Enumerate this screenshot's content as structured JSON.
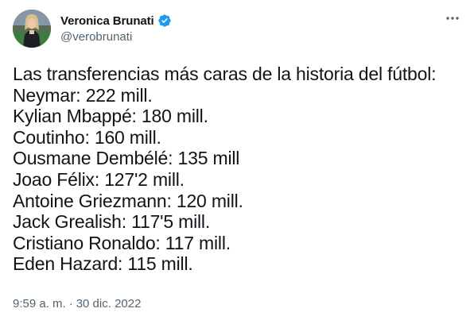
{
  "author": {
    "name": "Veronica Brunati",
    "handle": "@verobrunati",
    "verified": true
  },
  "tweet": {
    "lines": [
      "Las transferencias más caras de la historia del fútbol:",
      "Neymar: 222 mill.",
      "Kylian Mbappé: 180 mill.",
      "Coutinho: 160 mill.",
      "Ousmane Dembélé: 135 mill",
      "Joao Félix: 127'2 mill.",
      "Antoine Griezmann: 120 mill.",
      "Jack Grealish: 117'5 mill.",
      "Cristiano Ronaldo: 117 mill.",
      "Eden Hazard: 115 mill."
    ]
  },
  "meta": {
    "time": "9:59 a. m.",
    "separator": "·",
    "date": "30 dic. 2022"
  },
  "icons": {
    "verified": "verified-badge-icon",
    "more": "more-options-icon"
  },
  "colors": {
    "verified": "#1d9bf0",
    "text": "#0f1419",
    "secondary": "#536471"
  }
}
